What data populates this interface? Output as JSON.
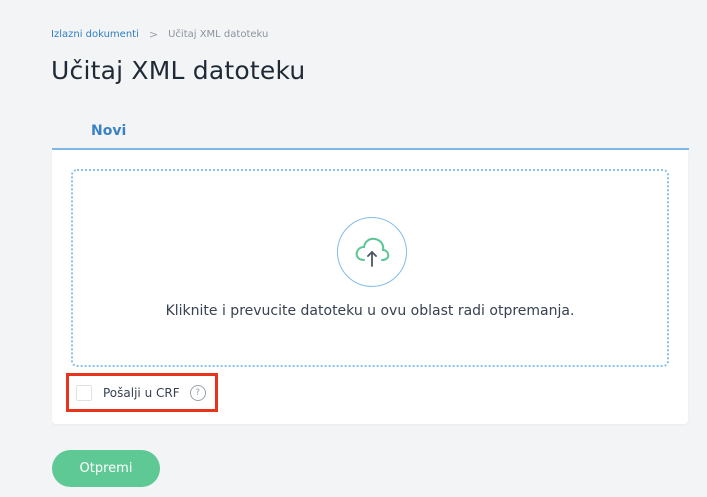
{
  "breadcrumb": {
    "parent": "Izlazni dokumenti",
    "separator": ">",
    "current": "Učitaj XML datoteku"
  },
  "page": {
    "title": "Učitaj XML datoteku"
  },
  "tabs": [
    {
      "label": "Novi",
      "active": true
    }
  ],
  "dropzone": {
    "icon": "cloud-upload-icon",
    "text": "Kliknite i prevucite datoteku u ovu oblast radi otpremanja."
  },
  "crf": {
    "label": "Pošalji u CRF",
    "checked": false,
    "help_symbol": "?"
  },
  "actions": {
    "submit_label": "Otpremi"
  },
  "colors": {
    "accent": "#3b82c4",
    "dropzone_border": "#8cc0ec",
    "submit_button": "#5ec995",
    "highlight": "#e8341c"
  }
}
